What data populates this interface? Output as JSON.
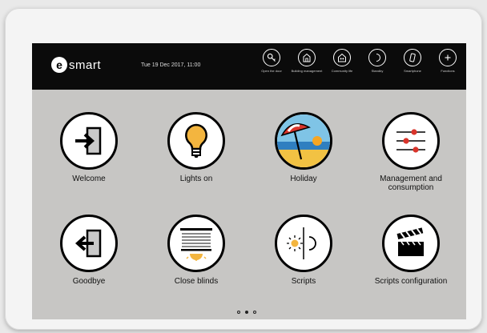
{
  "brand": {
    "logo_letter": "e",
    "name": "smart"
  },
  "datetime": "Tue 19 Dec 2017, 11:00",
  "toolbar": [
    {
      "icon": "key-icon",
      "label": "Open the door"
    },
    {
      "icon": "building-icon",
      "label": "Building management"
    },
    {
      "icon": "community-icon",
      "label": "Community life"
    },
    {
      "icon": "moon-icon",
      "label": "Standby"
    },
    {
      "icon": "smartphone-icon",
      "label": "Smartphone"
    },
    {
      "icon": "plus-icon",
      "label": "Functions"
    }
  ],
  "tiles": [
    {
      "icon": "enter-door-icon",
      "label": "Welcome"
    },
    {
      "icon": "lightbulb-icon",
      "label": "Lights on"
    },
    {
      "icon": "beach-umbrella-icon",
      "label": "Holiday"
    },
    {
      "icon": "sliders-icon",
      "label": "Management and consumption"
    },
    {
      "icon": "exit-door-icon",
      "label": "Goodbye"
    },
    {
      "icon": "blinds-icon",
      "label": "Close blinds"
    },
    {
      "icon": "sun-moon-icon",
      "label": "Scripts"
    },
    {
      "icon": "clapperboard-icon",
      "label": "Scripts configuration"
    }
  ],
  "pagination": {
    "pages": 3,
    "current": 2
  },
  "colors": {
    "bar": "#0b0b0b",
    "screen": "#c7c6c4",
    "slider_accent": "#d9342b",
    "bulb": "#f3b53f"
  }
}
